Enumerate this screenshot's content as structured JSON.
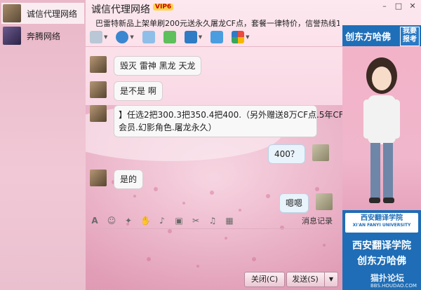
{
  "contacts": [
    {
      "name": "诚信代理网络",
      "active": true
    },
    {
      "name": "奔腾网络",
      "active": false
    }
  ],
  "window": {
    "title": "诚信代理网络",
    "vip_badge": "VIP6",
    "notice": "巴雷特新品上架单刷200元送永久屠龙CF点，套餐一律特价，信誉热线1..."
  },
  "messages": [
    {
      "from": "other",
      "text": "毁灭  雷神  黑龙  天龙"
    },
    {
      "from": "other",
      "text": "是不是 啊"
    },
    {
      "from": "other",
      "line1": "】任选2把300.3把350.4把400.（另外赠送8万CF点.5年CF",
      "line2": "会员.幻影角色.屠龙永久）"
    },
    {
      "from": "me",
      "text": "400？"
    },
    {
      "from": "other",
      "text": "是的"
    },
    {
      "from": "me",
      "text": "嗯嗯"
    }
  ],
  "input": {
    "history_label": "消息记录",
    "close_label": "关闭(C)",
    "send_label": "发送(S)"
  },
  "ad": {
    "top_text": "创东方哈佛",
    "report": "我要报考",
    "logo_text": "西安翻译学院",
    "logo_sub": "XI'AN FANYI UNIVERSITY",
    "school": "西安翻译学院",
    "name": "创东方哈佛",
    "watermark": "猫扑论坛",
    "watermark_sub": "BBS.HOUDAO.COM"
  }
}
